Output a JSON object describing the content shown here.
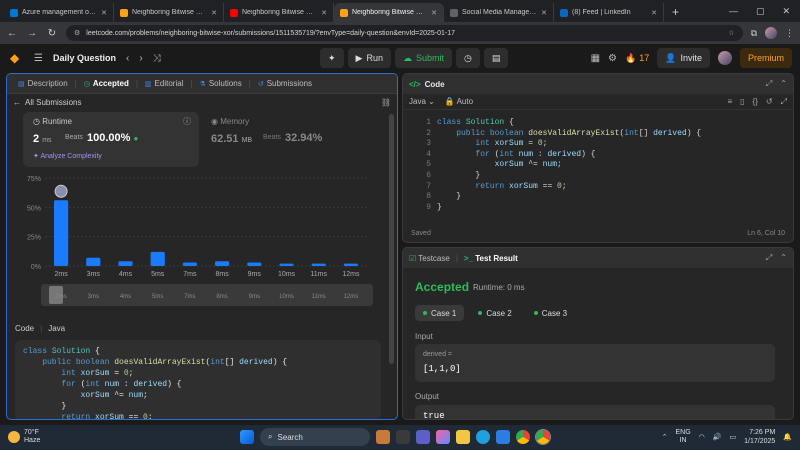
{
  "browser": {
    "tabs": [
      {
        "title": "Azure management options",
        "color": "#0078d4",
        "active": false
      },
      {
        "title": "Neighboring Bitwise XOR",
        "color": "#ffa116",
        "active": false
      },
      {
        "title": "Neighboring Bitwise XOR",
        "color": "#ff0000",
        "active": false
      },
      {
        "title": "Neighboring Bitwise XOR",
        "color": "#ffa116",
        "active": true
      },
      {
        "title": "Social Media Manager|Cor",
        "color": "#5f6368",
        "active": false
      },
      {
        "title": "(8) Feed | LinkedIn",
        "color": "#0a66c2",
        "active": false
      }
    ],
    "url": "leetcode.com/problems/neighboring-bitwise-xor/submissions/1511535719/?envType=daily-question&envId=2025-01-17"
  },
  "header": {
    "title": "Daily Question",
    "run_label": "Run",
    "submit_label": "Submit",
    "streak": "17",
    "invite_label": "Invite",
    "premium_label": "Premium"
  },
  "left": {
    "tabs": [
      {
        "label": "Description",
        "active": false
      },
      {
        "label": "Accepted",
        "active": true
      },
      {
        "label": "Editorial",
        "active": false
      },
      {
        "label": "Solutions",
        "active": false
      },
      {
        "label": "Submissions",
        "active": false
      }
    ],
    "back_label": "All Submissions",
    "runtime": {
      "label": "Runtime",
      "value": "2",
      "unit": "ms",
      "beats_label": "Beats",
      "beats": "100.00%",
      "analyze": "Analyze Complexity"
    },
    "memory": {
      "label": "Memory",
      "value": "62.51",
      "unit": "MB",
      "beats_label": "Beats",
      "beats": "32.94%"
    },
    "code_label": "Code",
    "code_lang": "Java",
    "code": [
      "class Solution {",
      "    public boolean doesValidArrayExist(int[] derived) {",
      "        int xorSum = 0;",
      "        for (int num : derived) {",
      "            xorSum ^= num;",
      "        }",
      "        return xorSum == 0;"
    ]
  },
  "chart_data": {
    "type": "bar",
    "categories": [
      "2ms",
      "3ms",
      "4ms",
      "5ms",
      "7ms",
      "8ms",
      "9ms",
      "10ms",
      "11ms",
      "12ms"
    ],
    "values": [
      56,
      7,
      4,
      12,
      3,
      4,
      3,
      2,
      2,
      2
    ],
    "y_ticks": [
      "75%",
      "50%",
      "25%",
      "0%"
    ],
    "ylim": [
      0,
      75
    ],
    "highlight": "2ms",
    "bar_color": "#1a7bff",
    "grid": true
  },
  "editor": {
    "title": "Code",
    "lang": "Java",
    "mode": "Auto",
    "status": "Saved",
    "position": "Ln 6, Col 10",
    "lines": [
      "class Solution {",
      "    public boolean doesValidArrayExist(int[] derived) {",
      "        int xorSum = 0;",
      "        for (int num : derived) {",
      "            xorSum ^= num;",
      "        }",
      "        return xorSum == 0;",
      "    }",
      "}"
    ]
  },
  "test": {
    "tab_testcase": "Testcase",
    "tab_result": "Test Result",
    "status": "Accepted",
    "runtime": "Runtime: 0 ms",
    "cases": [
      "Case 1",
      "Case 2",
      "Case 3"
    ],
    "input_label": "Input",
    "input_name": "derived =",
    "input_value": "[1,1,0]",
    "output_label": "Output",
    "output_value": "true"
  },
  "taskbar": {
    "temp": "70°F",
    "weather": "Haze",
    "search": "Search",
    "lang1": "ENG",
    "lang2": "IN",
    "time": "7:26 PM",
    "date": "1/17/2025",
    "badge": "1"
  }
}
